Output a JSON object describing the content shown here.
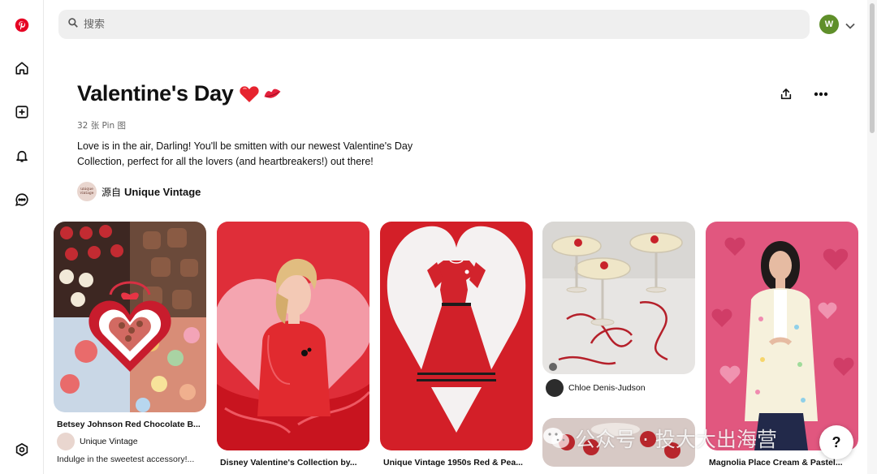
{
  "search": {
    "placeholder": "搜索"
  },
  "account": {
    "initial": "W",
    "color": "#5f8f2a"
  },
  "sidebar": [
    {
      "icon": "pinterest-logo-icon"
    },
    {
      "icon": "home-icon"
    },
    {
      "icon": "create-icon"
    },
    {
      "icon": "notifications-icon"
    },
    {
      "icon": "messages-icon"
    },
    {
      "icon": "settings-icon"
    }
  ],
  "board": {
    "title": "Valentine's Day",
    "title_emoji": [
      "red-heart",
      "kiss-mark"
    ],
    "pin_count": "32 张 Pin 图",
    "description": "Love is in the air, Darling! You'll be smitten with our newest Valentine's Day Collection, perfect for all the lovers (and heartbreakers!) out there!",
    "source_prefix": "源自",
    "source_name": "Unique Vintage",
    "source_logo_text": "unique vintage"
  },
  "pins": [
    {
      "title": "Betsey Johnson Red Chocolate B...",
      "author": "Unique Vintage",
      "description": "Indulge in the sweetest accessory!..."
    },
    {
      "title": "Disney Valentine's Collection by..."
    },
    {
      "title": "Unique Vintage 1950s Red & Pea..."
    },
    {
      "author": "Chloe Denis-Judson"
    },
    {
      "title": "Magnolia Place Cream & Pastel..."
    }
  ],
  "overlay": {
    "watermark": "公众号 · 投大大出海营",
    "help": "?"
  },
  "colors": {
    "brand": "#e60023",
    "search_bg": "#efefef"
  }
}
